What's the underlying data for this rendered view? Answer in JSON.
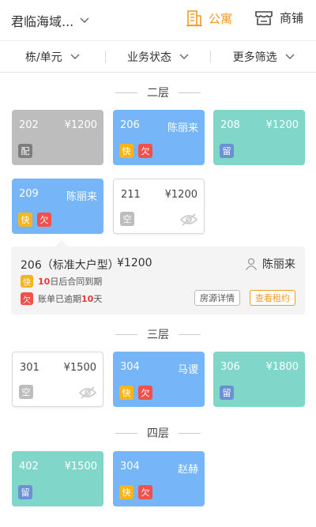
{
  "header": {
    "project": "君临海域...",
    "tabs": [
      {
        "label": "公寓",
        "active": true,
        "icon": "building-icon"
      },
      {
        "label": "商铺",
        "active": false,
        "icon": "store-icon"
      }
    ],
    "accent_color": "#f39a22"
  },
  "filters": [
    "栋/单元",
    "业务状态",
    "更多筛选"
  ],
  "floors": [
    {
      "title": "二层",
      "rooms": [
        {
          "num": "202",
          "value": "¥1200",
          "color": "gray",
          "tags": [
            "配"
          ]
        },
        {
          "num": "206",
          "value": "陈丽来",
          "color": "blue",
          "tags": [
            "快",
            "欠"
          ]
        },
        {
          "num": "208",
          "value": "¥1200",
          "color": "teal",
          "tags": [
            "留"
          ]
        },
        {
          "num": "209",
          "value": "陈丽来",
          "color": "blue",
          "tags": [
            "快",
            "欠"
          ]
        },
        {
          "num": "211",
          "value": "¥1200",
          "color": "white",
          "tags": [
            "空"
          ],
          "icon": "eye-slash-icon"
        }
      ]
    },
    {
      "title": "三层",
      "rooms": [
        {
          "num": "301",
          "value": "¥1500",
          "color": "white",
          "tags": [
            "空"
          ],
          "icon": "eye-slash-icon"
        },
        {
          "num": "304",
          "value": "马谡",
          "color": "blue",
          "tags": [
            "快",
            "欠"
          ]
        },
        {
          "num": "306",
          "value": "¥1800",
          "color": "teal",
          "tags": [
            "留"
          ]
        }
      ]
    },
    {
      "title": "四层",
      "rooms": [
        {
          "num": "402",
          "value": "¥1500",
          "color": "teal",
          "tags": [
            "留"
          ]
        },
        {
          "num": "304",
          "value": "赵赫",
          "color": "blue",
          "tags": [
            "快",
            "欠"
          ]
        }
      ]
    }
  ],
  "detail": {
    "room": "206（标准大户型）",
    "price": "¥1200",
    "tenant": "陈丽来",
    "expire": {
      "tag": "快",
      "num": "10",
      "text": "日后合同到期"
    },
    "overdue": {
      "tag": "欠",
      "prefix": "账单已逾期",
      "num": "10",
      "suffix": "天"
    },
    "buttons": {
      "detail": "房源详情",
      "contract": "查看租约"
    }
  }
}
